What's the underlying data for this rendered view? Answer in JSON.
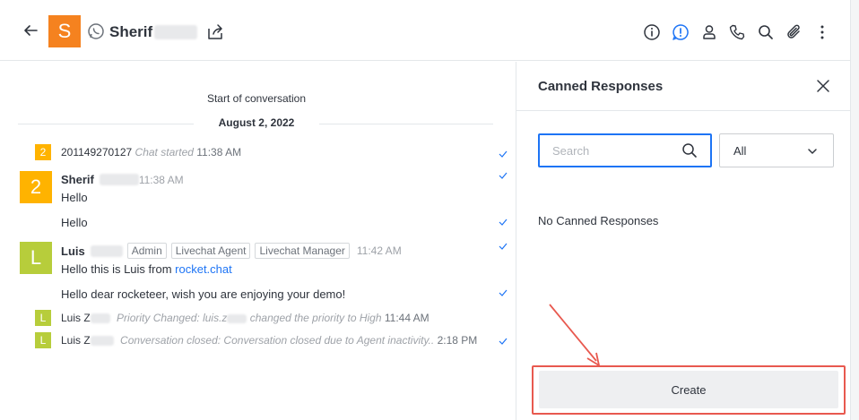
{
  "header": {
    "avatar_letter": "S",
    "contact_name": "Sherif",
    "icons": [
      "info-icon",
      "priority-alert-icon",
      "user-icon",
      "phone-icon",
      "search-icon",
      "attachment-icon",
      "kebab-menu-icon"
    ],
    "accent": "#1d74f5",
    "avatar_color": "#f5821f"
  },
  "conversation": {
    "start_label": "Start of conversation",
    "date_label": "August 2, 2022",
    "system_1": {
      "avatar": "2",
      "name": "201149270127",
      "event": "Chat started",
      "time": "11:38 AM"
    },
    "message_1": {
      "avatar": "2",
      "author": "Sherif",
      "time": "11:38 AM",
      "text": "Hello",
      "text_2": "Hello"
    },
    "message_2": {
      "avatar": "L",
      "author": "Luis",
      "roles": [
        "Admin",
        "Livechat Agent",
        "Livechat Manager"
      ],
      "time": "11:42 AM",
      "text_prefix": "Hello this is Luis from ",
      "link": "rocket.chat",
      "text_2": "Hello dear rocketeer, wish you are enjoying your demo!"
    },
    "system_2": {
      "avatar": "L",
      "name": "Luis Z",
      "event": "Priority Changed: luis.z",
      "event_suffix": " changed the priority to High",
      "time": "11:44 AM"
    },
    "system_3": {
      "avatar": "L",
      "name": "Luis Z",
      "event": "Conversation closed: Conversation closed due to Agent inactivity..",
      "time": "2:18 PM"
    }
  },
  "canned_panel": {
    "title": "Canned Responses",
    "search_placeholder": "Search",
    "filter_value": "All",
    "empty_text": "No Canned Responses",
    "create_label": "Create",
    "highlight_color": "#e8594f"
  }
}
